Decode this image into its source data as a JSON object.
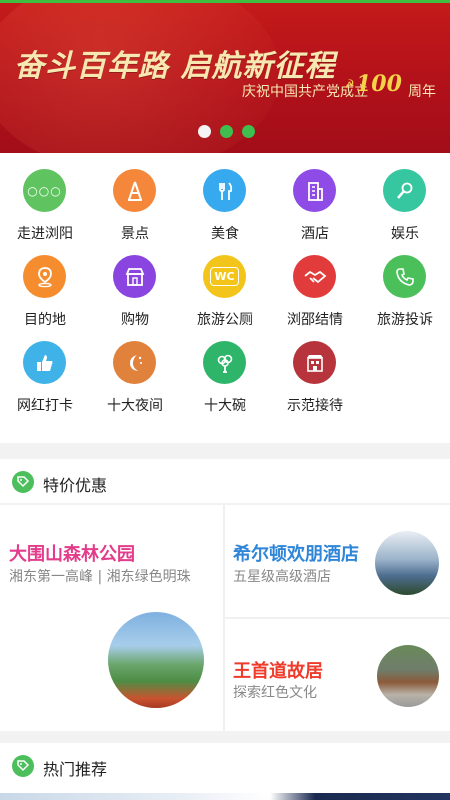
{
  "banner": {
    "slogan": "奋斗百年路  启航新征程",
    "subtitle": "庆祝中国共产党成立",
    "number": "100",
    "suffix": "周年",
    "dots": 3,
    "active_dot": 0
  },
  "grid": {
    "items": [
      {
        "label": "走进浏阳",
        "icon": "dots-icon",
        "color": "#5fc35f"
      },
      {
        "label": "景点",
        "icon": "tower-icon",
        "color": "#f5873b"
      },
      {
        "label": "美食",
        "icon": "fork-knife-icon",
        "color": "#36a9ef"
      },
      {
        "label": "酒店",
        "icon": "building-icon",
        "color": "#8e4be6"
      },
      {
        "label": "娱乐",
        "icon": "microphone-icon",
        "color": "#37c7a0"
      },
      {
        "label": "目的地",
        "icon": "map-pin-icon",
        "color": "#f58d2e"
      },
      {
        "label": "购物",
        "icon": "shop-icon",
        "color": "#8a45e0"
      },
      {
        "label": "旅游公厕",
        "icon": "wc-icon",
        "color": "#f3c51b"
      },
      {
        "label": "浏邵结情",
        "icon": "handshake-icon",
        "color": "#e23b3b"
      },
      {
        "label": "旅游投诉",
        "icon": "phone-icon",
        "color": "#4bbf5a"
      },
      {
        "label": "网红打卡",
        "icon": "thumbs-up-icon",
        "color": "#3fb2e8"
      },
      {
        "label": "十大夜间",
        "icon": "moon-icon",
        "color": "#e0813c"
      },
      {
        "label": "十大碗",
        "icon": "broccoli-icon",
        "color": "#2fb56a"
      },
      {
        "label": "示范接待",
        "icon": "storefront-icon",
        "color": "#b8343c"
      }
    ]
  },
  "deals_section": {
    "title": "特价优惠"
  },
  "deals": {
    "left": {
      "name": "大围山森林公园",
      "desc": "湘东第一高峰 | 湘东绿色明珠",
      "color": "#e33c8b"
    },
    "right1": {
      "name": "希尔顿欢朋酒店",
      "desc": "五星级高级酒店",
      "color": "#2f86d8"
    },
    "right2": {
      "name": "王首道故居",
      "desc": "探索红色文化",
      "color": "#ee3b2a"
    }
  },
  "hot_section": {
    "title": "热门推荐"
  }
}
